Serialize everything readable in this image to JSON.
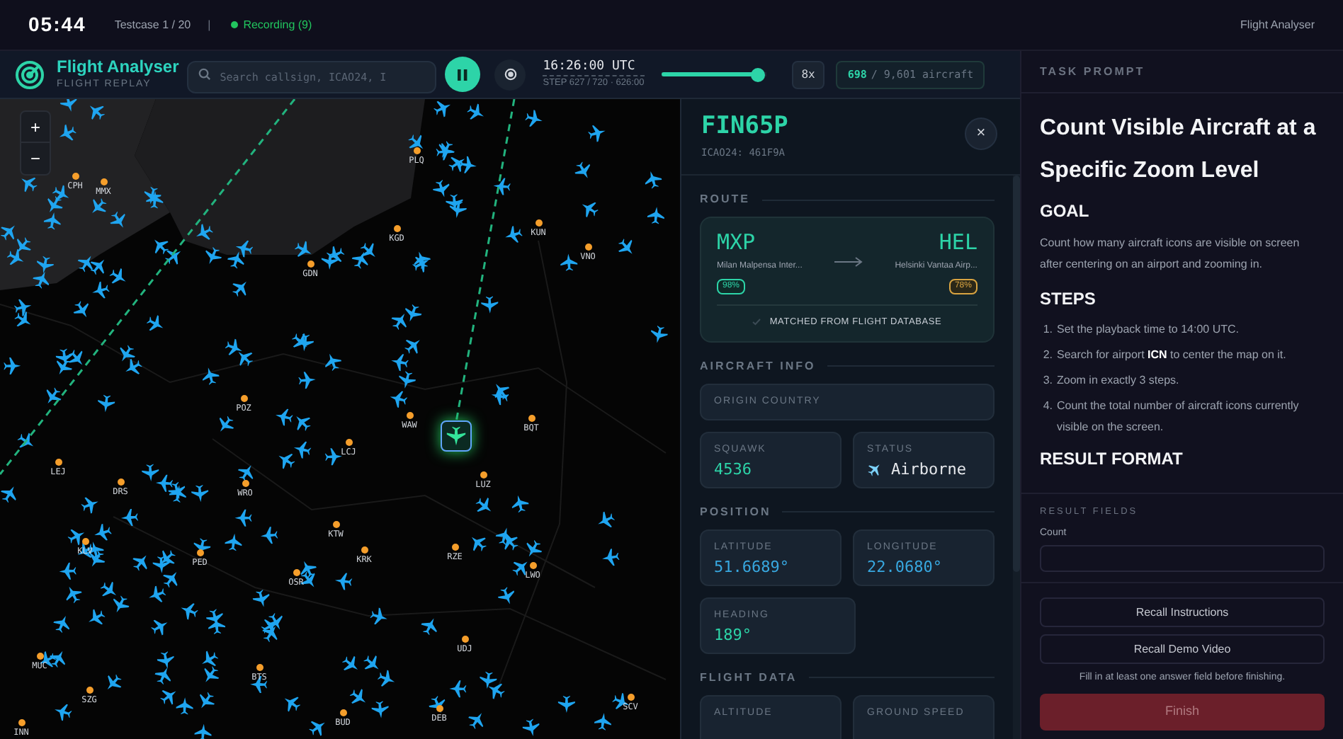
{
  "top_bar": {
    "timer": "05:44",
    "testcase": "Testcase 1 / 20",
    "separator": "|",
    "recording": "Recording (9)",
    "app_name": "Flight Analyser"
  },
  "header": {
    "title": "Flight Analyser",
    "subtitle": "FLIGHT REPLAY",
    "search": {
      "placeholder": "Search callsign, ICAO24, I"
    },
    "time": "16:26:00 UTC",
    "step": "STEP 627 / 720 · 626:00",
    "timeline": {
      "level": 0.92
    },
    "speed": "8x",
    "aircraft_visible": "698",
    "aircraft_total": "/ 9,601 aircraft"
  },
  "map": {
    "zoom_in": "+",
    "zoom_out": "−",
    "airports": [
      {
        "code": "PLQ"
      },
      {
        "code": "CPH"
      },
      {
        "code": "MMX"
      },
      {
        "code": "KGD"
      },
      {
        "code": "KUN"
      },
      {
        "code": "VNO"
      },
      {
        "code": "GDN"
      },
      {
        "code": "POZ"
      },
      {
        "code": "WAW"
      },
      {
        "code": "BQT"
      },
      {
        "code": "LCJ"
      },
      {
        "code": "LUZ"
      },
      {
        "code": "LEJ"
      },
      {
        "code": "DRS"
      },
      {
        "code": "WRO"
      },
      {
        "code": "KLV"
      },
      {
        "code": "PED"
      },
      {
        "code": "KTW"
      },
      {
        "code": "KRK"
      },
      {
        "code": "RZE"
      },
      {
        "code": "OSR"
      },
      {
        "code": "LWO"
      },
      {
        "code": "UDJ"
      },
      {
        "code": "MUC"
      },
      {
        "code": "SZG"
      },
      {
        "code": "BTS"
      },
      {
        "code": "DEB"
      },
      {
        "code": "SCV"
      },
      {
        "code": "INN"
      },
      {
        "code": "BUD"
      }
    ]
  },
  "flight": {
    "callsign": "FIN65P",
    "icao": "ICAO24: 461F9A",
    "close": "×",
    "route_label": "ROUTE",
    "origin": {
      "code": "MXP",
      "name": "Milan Malpensa Inter...",
      "confidence": "98%",
      "color": "#2dd4a8"
    },
    "destination": {
      "code": "HEL",
      "name": "Helsinki Vantaa Airp...",
      "confidence": "78%",
      "color": "#d9a441"
    },
    "matched": "MATCHED FROM FLIGHT DATABASE",
    "aircraft_info_label": "AIRCRAFT INFO",
    "origin_country": "ORIGIN COUNTRY",
    "squawk": {
      "label": "SQUAWK",
      "value": "4536"
    },
    "status": {
      "label": "STATUS",
      "value": "Airborne"
    },
    "position_label": "POSITION",
    "latitude": {
      "label": "LATITUDE",
      "value": "51.6689°"
    },
    "longitude": {
      "label": "LONGITUDE",
      "value": "22.0680°"
    },
    "heading": {
      "label": "HEADING",
      "value": "189°"
    },
    "flight_data_label": "FLIGHT DATA",
    "altitude": {
      "label": "ALTITUDE"
    },
    "ground_speed": {
      "label": "GROUND SPEED"
    }
  },
  "task": {
    "header": "TASK PROMPT",
    "title": "Count Visible Aircraft at a Specific Zoom Level",
    "goal_heading": "GOAL",
    "goal": "Count how many aircraft icons are visible on screen after centering on an airport and zooming in.",
    "steps_heading": "STEPS",
    "steps": [
      {
        "number": "1.",
        "text": "Set the playback time to 14:00 UTC."
      },
      {
        "number": "2.",
        "text": "Search for airport **ICN** to center the map on it."
      },
      {
        "number": "3.",
        "text": "Zoom in exactly 3 steps."
      },
      {
        "number": "4.",
        "text": "Count the total number of aircraft icons currently visible on the screen."
      }
    ],
    "result_format_heading": "RESULT FORMAT",
    "result_fields_label": "RESULT FIELDS",
    "count_label": "Count",
    "recall_instructions": "Recall Instructions",
    "recall_demo": "Recall Demo Video",
    "hint": "Fill in at least one answer field before finishing.",
    "finish": {
      "label": "Finish",
      "disabled": true
    }
  }
}
